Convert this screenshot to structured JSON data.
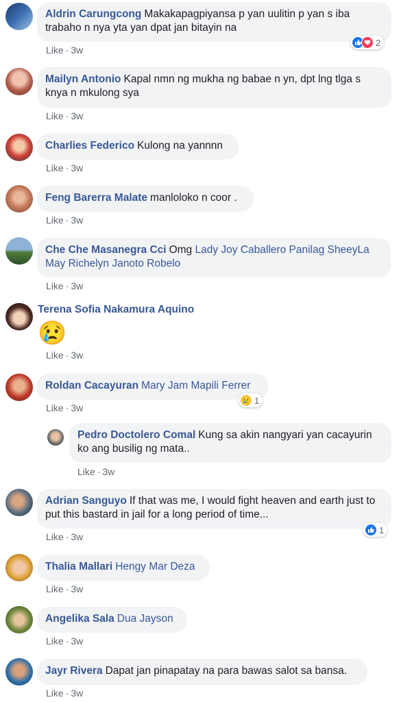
{
  "comments": [
    {
      "name": "Aldrin Carungcong",
      "text": "Makakapagpiyansa p yan uulitin p yan s iba trabaho n nya yta yan dpat jan bitayin na",
      "like": "Like",
      "time": "3w",
      "reaction_count": "2"
    },
    {
      "name": "Mailyn Antonio",
      "text": "Kapal nmn ng mukha ng babae n yn, dpt lng tlga s knya n mkulong sya",
      "like": "Like",
      "time": "3w"
    },
    {
      "name": "Charlies Federico",
      "text": "Kulong na yannnn",
      "like": "Like",
      "time": "3w"
    },
    {
      "name": "Feng Barerra Malate",
      "text": "manloloko n coor .",
      "like": "Like",
      "time": "3w"
    },
    {
      "name": "Che Che Masanegra Cci",
      "text": "Omg",
      "tags": "Lady Joy Caballero Panilag SheeyLa May Richelyn Janoto Robelo",
      "like": "Like",
      "time": "3w"
    },
    {
      "name": "Terena Sofia Nakamura Aquino",
      "emoji": "😢",
      "like": "Like",
      "time": "3w"
    },
    {
      "name": "Roldan Cacayuran",
      "tags": "Mary Jam Mapili Ferrer",
      "like": "Like",
      "time": "3w",
      "reaction_count": "1"
    },
    {
      "name": "Pedro Doctolero Comal",
      "text": "Kung sa akin nangyari yan cacayurin ko ang busilig ng mata..",
      "like": "Like",
      "time": "3w"
    },
    {
      "name": "Adrian Sanguyo",
      "text": "If that was me, I would fight heaven and earth just to put this bastard in jail for a long period of time...",
      "like": "Like",
      "time": "3w",
      "reaction_count": "1"
    },
    {
      "name": "Thalia Mallari",
      "tags": "Hengy Mar Deza",
      "like": "Like",
      "time": "3w"
    },
    {
      "name": "Angelika Sala",
      "tags": "Dua Jayson",
      "like": "Like",
      "time": "3w"
    },
    {
      "name": "Jayr Rivera",
      "text": "Dapat jan pinapatay na para bawas salot sa bansa.",
      "like": "Like",
      "time": "3w"
    }
  ],
  "reaction_icons": {
    "like": "thumbs-up-icon",
    "love": "heart-icon",
    "sad": "sad-face-icon"
  },
  "colors": {
    "name": "#385898",
    "bubble": "#f2f3f5",
    "meta": "#606770",
    "like_blue": "#1877f2",
    "love_red": "#f33e58"
  }
}
